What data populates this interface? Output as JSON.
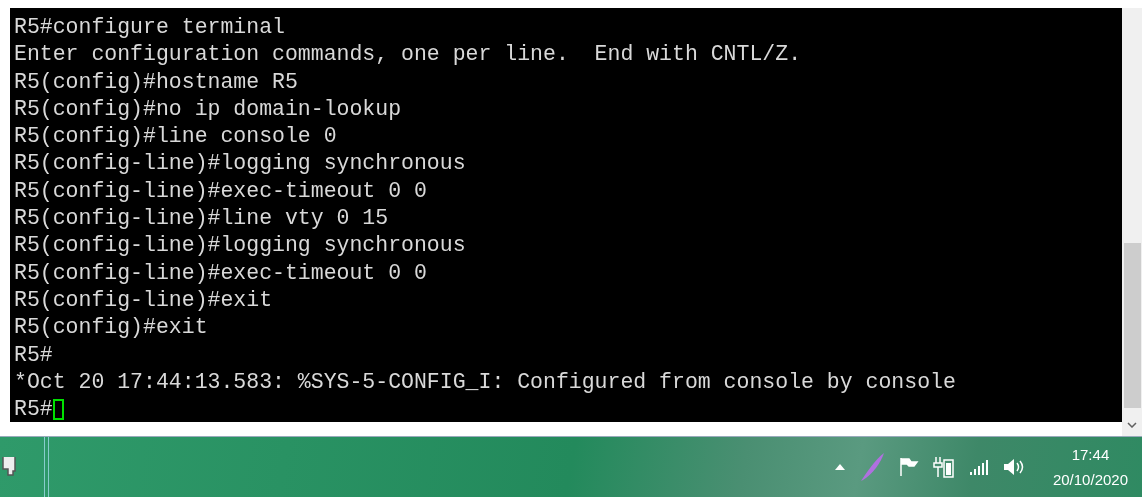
{
  "terminal": {
    "lines": [
      "R5#configure terminal",
      "Enter configuration commands, one per line.  End with CNTL/Z.",
      "R5(config)#hostname R5",
      "R5(config)#no ip domain-lookup",
      "R5(config)#line console 0",
      "R5(config-line)#logging synchronous",
      "R5(config-line)#exec-timeout 0 0",
      "R5(config-line)#line vty 0 15",
      "R5(config-line)#logging synchronous",
      "R5(config-line)#exec-timeout 0 0",
      "R5(config-line)#exit",
      "R5(config)#exit",
      "R5#",
      "*Oct 20 17:44:13.583: %SYS-5-CONFIG_I: Configured from console by console"
    ],
    "prompt": "R5#"
  },
  "taskbar": {
    "clock": {
      "time": "17:44",
      "date": "20/10/2020"
    }
  }
}
